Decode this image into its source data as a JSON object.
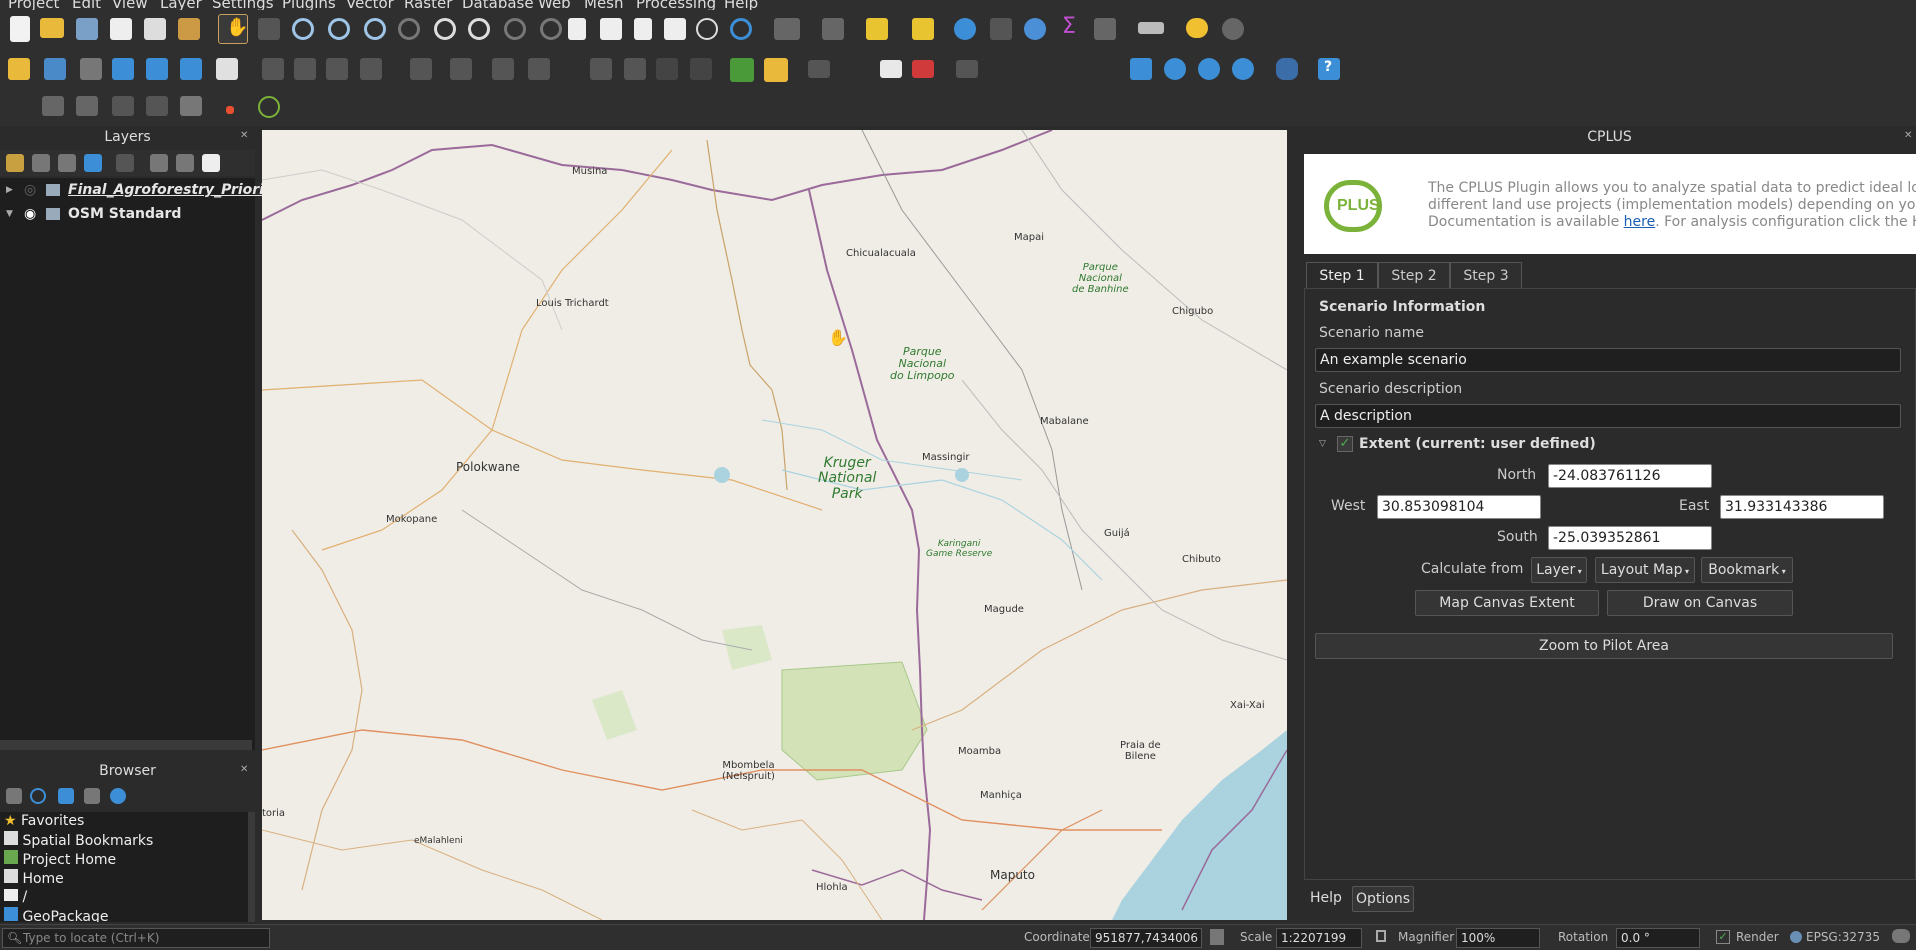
{
  "menu": [
    "Project",
    "Edit",
    "View",
    "Layer",
    "Settings",
    "Plugins",
    "Vector",
    "Raster",
    "Database",
    "Web",
    "Mesh",
    "Processing",
    "Help"
  ],
  "layers_panel": {
    "title": "Layers",
    "items": [
      {
        "name": "Final_Agroforestry_Priorit",
        "visible": false
      },
      {
        "name": "OSM Standard",
        "visible": true
      }
    ]
  },
  "browser_panel": {
    "title": "Browser",
    "items": [
      "Favorites",
      "Spatial Bookmarks",
      "Project Home",
      "Home",
      "/",
      "GeoPackage"
    ]
  },
  "map_labels": {
    "musina": "Musina",
    "chicualacuala": "Chicualacuala",
    "mapai": "Mapai",
    "louis": "Louis Trichardt",
    "parque_banhine_1": "Parque",
    "parque_banhine_2": "Nacional",
    "parque_banhine_3": "de Banhine",
    "chigubo": "Chigubo",
    "parque_limpopo_1": "Parque",
    "parque_limpopo_2": "Nacional",
    "parque_limpopo_3": "do Limpopo",
    "polokwane": "Polokwane",
    "kruger_1": "Kruger",
    "kruger_2": "National",
    "kruger_3": "Park",
    "massingir": "Massingir",
    "mabalane": "Mabalane",
    "mokopane": "Mokopane",
    "guija": "Guijá",
    "karingani_1": "Karingani",
    "karingani_2": "Game Reserve",
    "chibuto": "Chibuto",
    "magude": "Magude",
    "xaixai": "Xai-Xai",
    "mbombela_1": "Mbombela",
    "mbombela_2": "(Nelspruit)",
    "moamba": "Moamba",
    "praia_1": "Praia de",
    "praia_2": "Bilene",
    "manhica": "Manhiça",
    "malalane": "eMalahleni",
    "toria": "toria",
    "maputo": "Maputo",
    "hlohla": "Hlohla"
  },
  "cplus": {
    "title": "CPLUS",
    "intro_line1": "The CPLUS Plugin allows you to analyze spatial data to predict ideal loca",
    "intro_line2": "different land use projects (implementation models) depending on your",
    "intro_line3a": "Documentation is available ",
    "intro_link": "here",
    "intro_line3b": ". For analysis configuration click the Help",
    "logo_text": "PLUS",
    "tabs": [
      "Step 1",
      "Step 2",
      "Step 3"
    ],
    "section_title": "Scenario Information",
    "name_label": "Scenario name",
    "name_value": "An example scenario",
    "desc_label": "Scenario description",
    "desc_value": "A description",
    "extent_title": "Extent (current: user defined)",
    "north_label": "North",
    "north_value": "-24.083761126",
    "west_label": "West",
    "west_value": "30.853098104",
    "east_label": "East",
    "east_value": "31.933143386",
    "south_label": "South",
    "south_value": "-25.039352861",
    "calc_label": "Calculate from",
    "calc_layer": "Layer",
    "calc_layout": "Layout Map",
    "calc_bookmark": "Bookmark",
    "map_canvas_extent": "Map Canvas Extent",
    "draw_on_canvas": "Draw on Canvas",
    "zoom_pilot": "Zoom to Pilot Area",
    "help": "Help",
    "options": "Options"
  },
  "status": {
    "locate_placeholder": "Type to locate (Ctrl+K)",
    "coordinate_label": "Coordinate",
    "coordinate_value": "951877,7434006",
    "scale_label": "Scale",
    "scale_value": "1:2207199",
    "magnifier_label": "Magnifier",
    "magnifier_value": "100%",
    "rotation_label": "Rotation",
    "rotation_value": "0.0 °",
    "render_label": "Render",
    "crs": "EPSG:32735"
  }
}
